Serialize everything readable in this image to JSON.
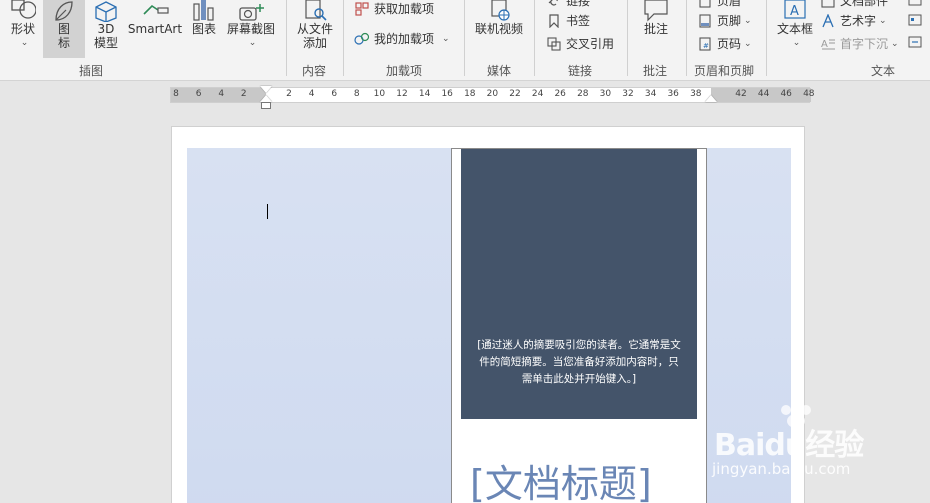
{
  "ribbon": {
    "illustrations": {
      "shape_label": "形状",
      "icon_label": "图标",
      "model3d_label": "3D\n模型",
      "smartart_label": "SmartArt",
      "chart_label": "图表",
      "screenshot_label": "屏幕截图",
      "group_label": "插图"
    },
    "content": {
      "from_file_label": "从文件\n添加",
      "group_label": "内容"
    },
    "addins": {
      "get_label": "获取加载项",
      "my_label": "我的加载项",
      "group_label": "加载项"
    },
    "media": {
      "online_video_label": "联机视频",
      "group_label": "媒体"
    },
    "links": {
      "link_label": "链接",
      "bookmark_label": "书签",
      "crossref_label": "交叉引用",
      "group_label": "链接"
    },
    "comments": {
      "comment_label": "批注",
      "group_label": "批注"
    },
    "header_footer": {
      "header_label": "页眉",
      "footer_label": "页脚",
      "page_number_label": "页码",
      "group_label": "页眉和页脚"
    },
    "text": {
      "textbox_label": "文本框",
      "quickparts_label": "文档部件",
      "wordart_label": "艺术字",
      "dropcap_label": "首字下沉",
      "group_label": "文本"
    }
  },
  "ruler": {
    "ticks": [
      "8",
      "6",
      "4",
      "2",
      "",
      "2",
      "4",
      "6",
      "8",
      "10",
      "12",
      "14",
      "16",
      "18",
      "20",
      "22",
      "24",
      "26",
      "28",
      "30",
      "32",
      "34",
      "36",
      "38",
      "",
      "42",
      "44",
      "46",
      "48"
    ]
  },
  "document": {
    "abstract": "[通过迷人的摘要吸引您的读者。它通常是文件的简短摘要。当您准备好添加内容时，只需单击此处并开始键入。]",
    "title": "[文档标题]"
  },
  "watermark": {
    "brand": "Baidu经验",
    "url": "jingyan.baidu.com"
  },
  "colors": {
    "dark_box": "#44546a",
    "panel": "#d8e1f2",
    "title": "#6a86b5"
  }
}
